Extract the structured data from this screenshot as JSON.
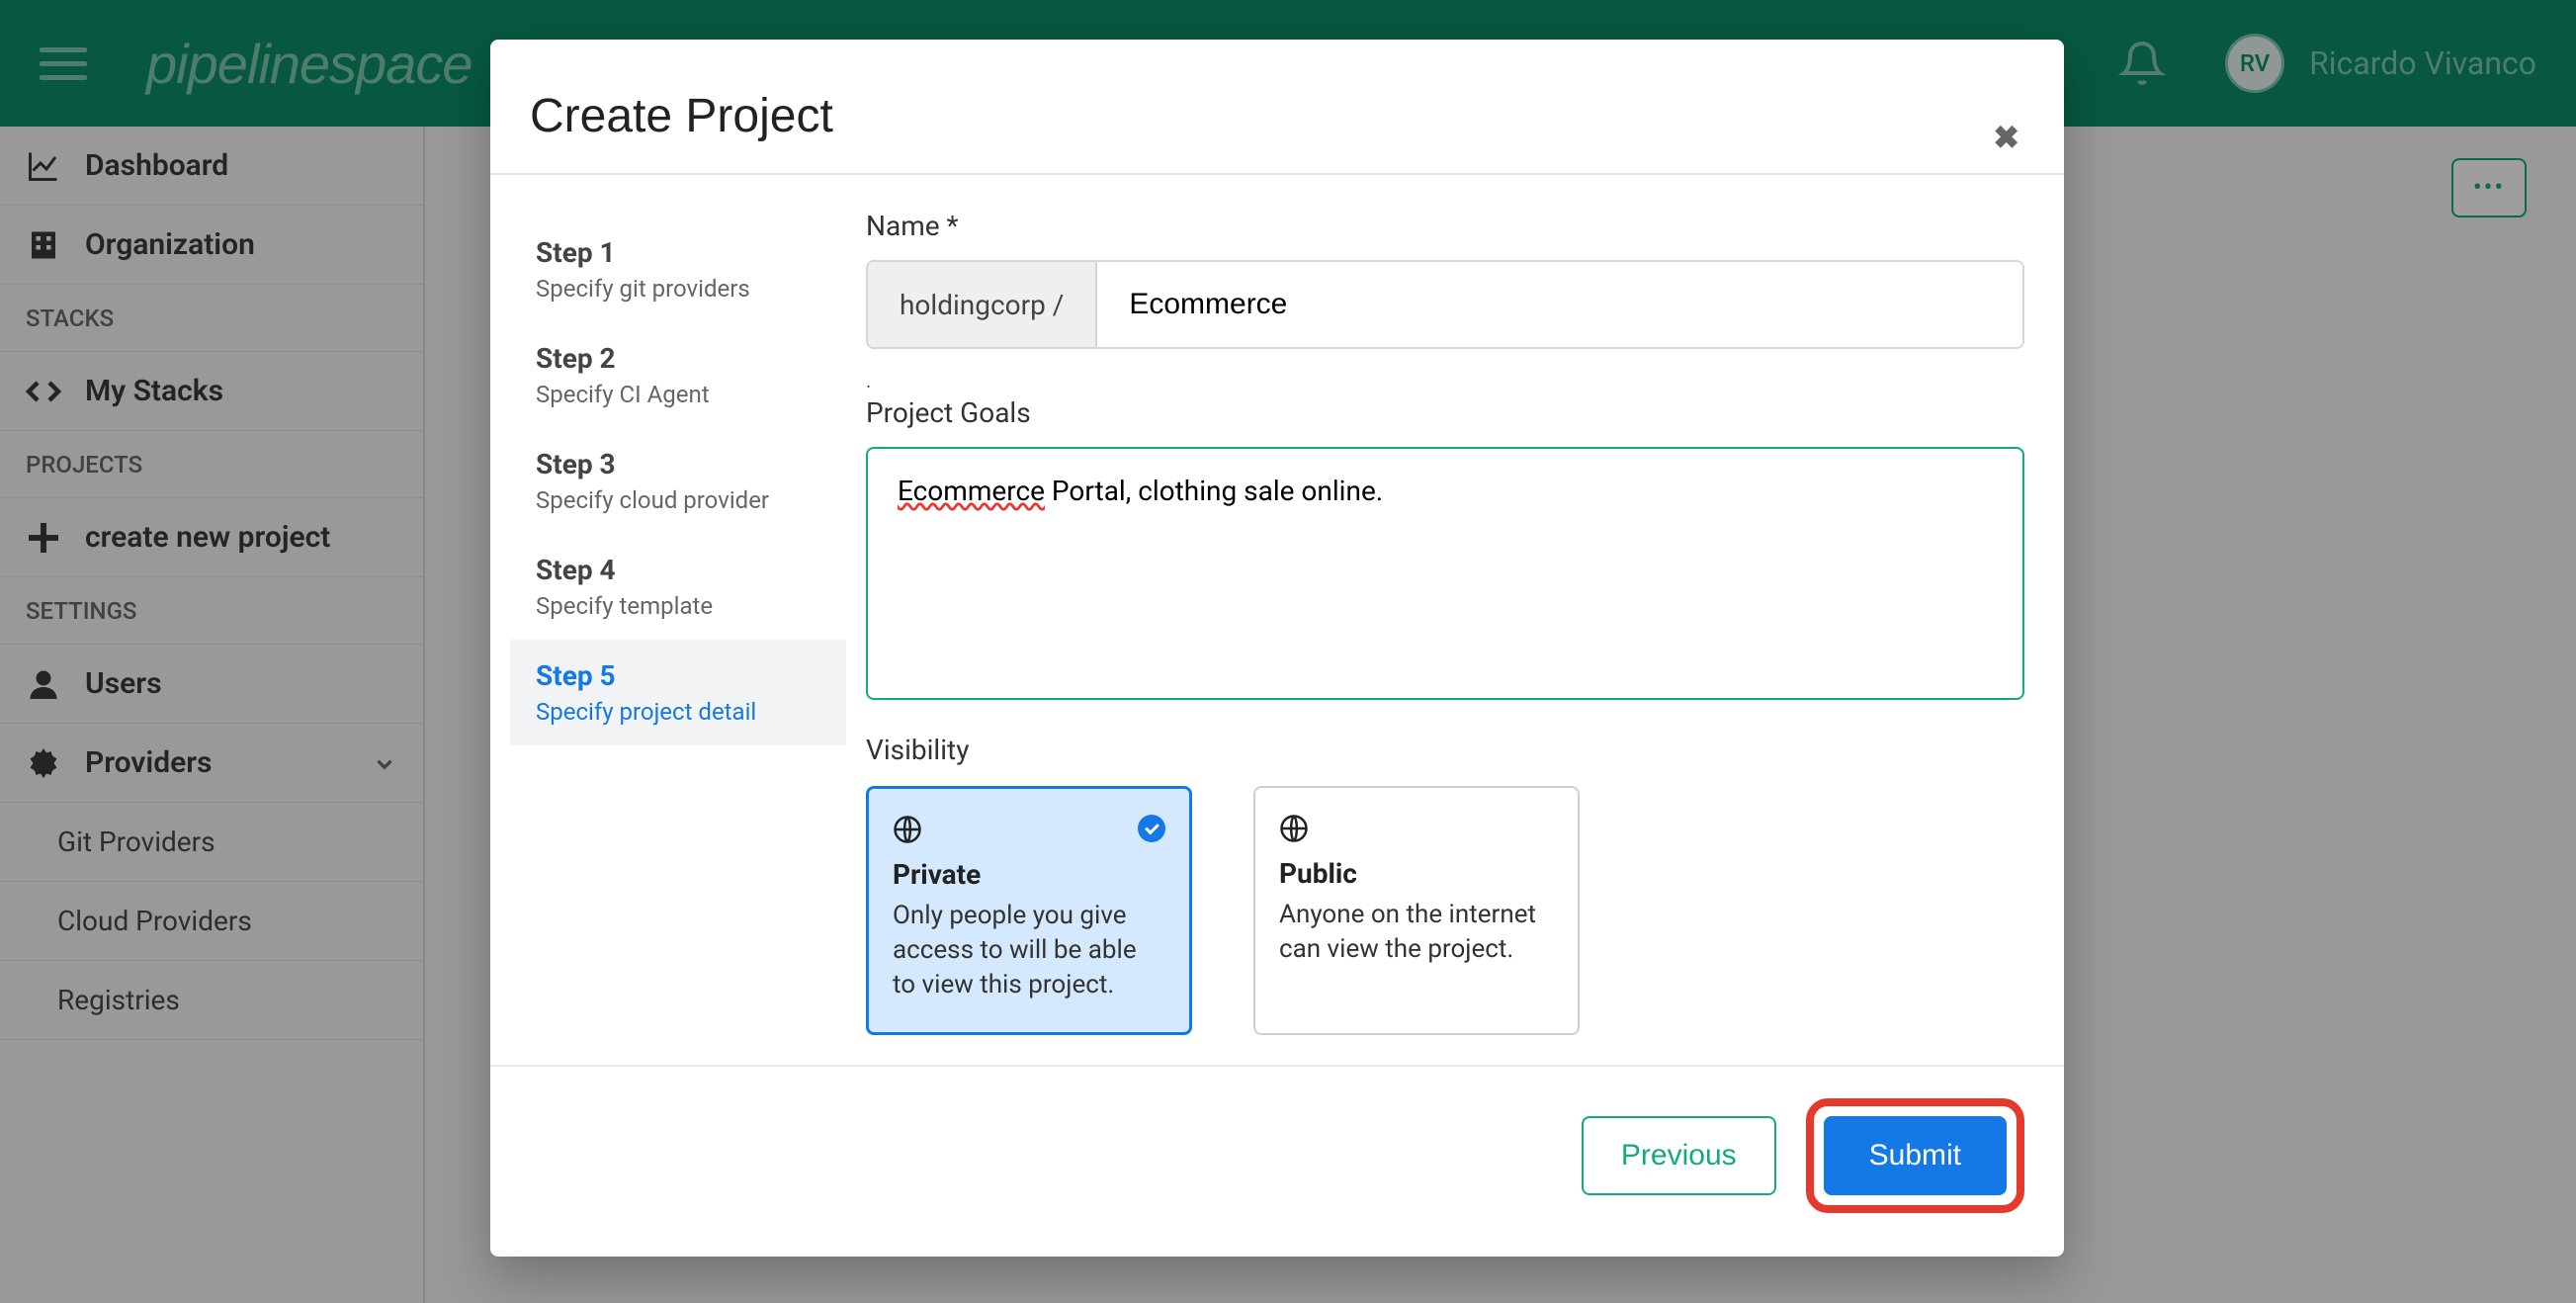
{
  "header": {
    "logo_text": "pipelinespace",
    "avatar_initials": "RV",
    "username": "Ricardo Vivanco"
  },
  "sidebar": {
    "dashboard": "Dashboard",
    "organization": "Organization",
    "stacks_header": "STACKS",
    "my_stacks": "My Stacks",
    "projects_header": "PROJECTS",
    "create_project": "create new project",
    "settings_header": "SETTINGS",
    "users": "Users",
    "providers": "Providers",
    "git_providers": "Git Providers",
    "cloud_providers": "Cloud Providers",
    "registries": "Registries"
  },
  "modal": {
    "title": "Create Project",
    "steps": [
      {
        "title": "Step 1",
        "desc": "Specify git providers"
      },
      {
        "title": "Step 2",
        "desc": "Specify CI Agent"
      },
      {
        "title": "Step 3",
        "desc": "Specify cloud provider"
      },
      {
        "title": "Step 4",
        "desc": "Specify template"
      },
      {
        "title": "Step 5",
        "desc": "Specify project detail"
      }
    ],
    "form": {
      "name_label": "Name *",
      "name_prefix": "holdingcorp /",
      "name_value": "Ecommerce",
      "tiny_label": ".",
      "goals_label": "Project Goals",
      "goals_value_part1": "Ecommerce",
      "goals_value_part2": " Portal, clothing sale online.",
      "visibility_label": "Visibility",
      "visibility": {
        "private": {
          "title": "Private",
          "desc": "Only people you give access to will be able to view this project."
        },
        "public": {
          "title": "Public",
          "desc": "Anyone on the internet can view the project."
        }
      }
    },
    "footer": {
      "previous": "Previous",
      "submit": "Submit"
    }
  },
  "more_button": "•••"
}
